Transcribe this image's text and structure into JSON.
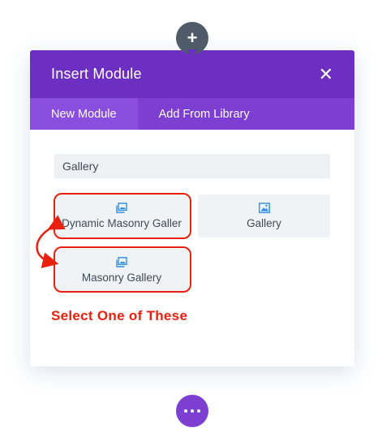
{
  "top_button": {
    "symbol": "+"
  },
  "modal": {
    "title": "Insert Module",
    "close_symbol": "✕",
    "tabs": [
      {
        "label": "New Module",
        "active": true
      },
      {
        "label": "Add From Library",
        "active": false
      }
    ],
    "search": {
      "value": "Gallery",
      "placeholder": ""
    },
    "modules": [
      {
        "label": "Dynamic Masonry Galler",
        "icon": "gallery-icon"
      },
      {
        "label": "Gallery",
        "icon": "image-icon"
      },
      {
        "label": "Masonry Gallery",
        "icon": "gallery-icon"
      }
    ],
    "annotation": "Select One of These"
  },
  "bottom_button": {
    "icon": "more-dots-icon"
  },
  "colors": {
    "header": "#6d2fc1",
    "tabs": "#7d3fd2",
    "active_tab": "#8b4fe0",
    "highlight": "#e8210f",
    "icon_blue": "#2e8de4",
    "top_button": "#4f5b69"
  }
}
